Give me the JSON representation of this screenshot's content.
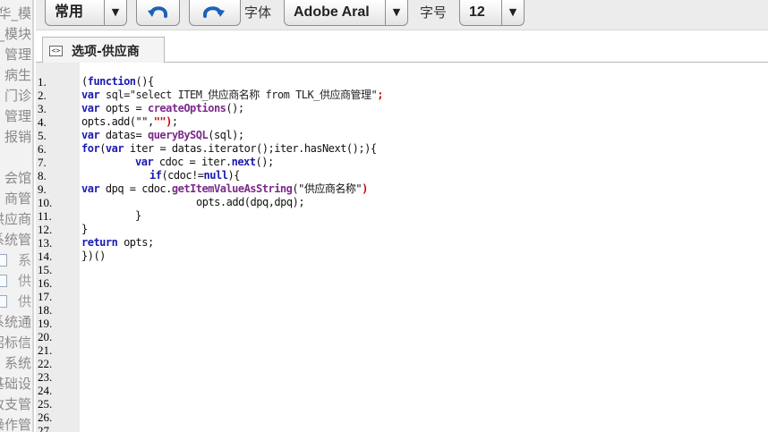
{
  "sidebar": {
    "items": [
      {
        "text": "华_模",
        "child": false
      },
      {
        "text": "_模块",
        "child": false
      },
      {
        "text": "管理",
        "child": false
      },
      {
        "text": "病生",
        "child": false
      },
      {
        "text": "门诊",
        "child": false
      },
      {
        "text": "管理",
        "child": false
      },
      {
        "text": "报销",
        "child": false
      },
      {
        "text": "",
        "child": false
      },
      {
        "text": "会馆",
        "child": false
      },
      {
        "text": "商管",
        "child": false
      },
      {
        "text": "供应商",
        "child": false
      },
      {
        "text": "系统管",
        "child": false
      },
      {
        "text": "系",
        "child": true
      },
      {
        "text": "供",
        "child": true
      },
      {
        "text": "供",
        "child": true
      },
      {
        "text": "系统通",
        "child": false
      },
      {
        "text": "招标信",
        "child": false
      },
      {
        "text": "系统",
        "child": false
      },
      {
        "text": "基础设",
        "child": false
      },
      {
        "text": "收支管",
        "child": false
      },
      {
        "text": "操作管",
        "child": false
      }
    ]
  },
  "toolbar": {
    "style_select": {
      "value": "常用",
      "arrow": "▼"
    },
    "undo_icon": "undo-icon",
    "redo_icon": "redo-icon",
    "font_label": "字体",
    "font_select": {
      "value": "Adobe Aral",
      "arrow": "▼"
    },
    "size_label": "字号",
    "size_select": {
      "value": "12",
      "arrow": "▼"
    }
  },
  "tab": {
    "icon_text": "<>",
    "label": "选项-供应商"
  },
  "editor": {
    "line_numbers": [
      "1.",
      "2.",
      "3.",
      "4.",
      "5.",
      "6.",
      "7.",
      "8.",
      "9.",
      "10.",
      "11.",
      "12.",
      "13.",
      "14.",
      "15.",
      "16.",
      "17.",
      "18.",
      "19.",
      "20.",
      "21.",
      "22.",
      "23.",
      "24.",
      "25.",
      "26.",
      "27."
    ],
    "lines": [
      {
        "indent": 0,
        "tokens": [
          {
            "t": "(",
            "c": ""
          },
          {
            "t": "function",
            "c": "kw"
          },
          {
            "t": "(){",
            "c": ""
          }
        ]
      },
      {
        "indent": 0,
        "tokens": [
          {
            "t": "var",
            "c": "kw"
          },
          {
            "t": " sql=\"select ITEM_供应商名称 from TLK_供应商管理\"",
            "c": "str"
          },
          {
            "t": ";",
            "c": "red"
          }
        ]
      },
      {
        "indent": 0,
        "tokens": [
          {
            "t": "var",
            "c": "kw"
          },
          {
            "t": " opts = ",
            "c": ""
          },
          {
            "t": "createOptions",
            "c": "fn"
          },
          {
            "t": "();",
            "c": ""
          }
        ]
      },
      {
        "indent": 0,
        "tokens": [
          {
            "t": "opts.add(\"\",",
            "c": ""
          },
          {
            "t": "\"\")",
            "c": "red"
          },
          {
            "t": ";",
            "c": ""
          }
        ]
      },
      {
        "indent": 0,
        "tokens": [
          {
            "t": "var",
            "c": "kw"
          },
          {
            "t": " datas= ",
            "c": ""
          },
          {
            "t": "queryBySQL",
            "c": "fn"
          },
          {
            "t": "(sql);",
            "c": ""
          }
        ]
      },
      {
        "indent": 0,
        "tokens": [
          {
            "t": "for",
            "c": "kw"
          },
          {
            "t": "(",
            "c": ""
          },
          {
            "t": "var",
            "c": "kw"
          },
          {
            "t": " iter = datas.iterator();iter.hasNext();){",
            "c": ""
          }
        ]
      },
      {
        "indent": 60,
        "tokens": [
          {
            "t": "var",
            "c": "kw"
          },
          {
            "t": " cdoc = iter.",
            "c": ""
          },
          {
            "t": "next",
            "c": "kw"
          },
          {
            "t": "();",
            "c": ""
          }
        ]
      },
      {
        "indent": 76,
        "tokens": [
          {
            "t": "if",
            "c": "kw"
          },
          {
            "t": "(cdoc!=",
            "c": ""
          },
          {
            "t": "null",
            "c": "kw"
          },
          {
            "t": "){",
            "c": ""
          }
        ]
      },
      {
        "indent": 0,
        "tokens": [
          {
            "t": "var",
            "c": "kw"
          },
          {
            "t": " dpq = cdoc.",
            "c": ""
          },
          {
            "t": "getItemValueAsString",
            "c": "fn"
          },
          {
            "t": "(\"供应商名称\"",
            "c": ""
          },
          {
            "t": ")",
            "c": "red"
          }
        ]
      },
      {
        "indent": 128,
        "tokens": [
          {
            "t": "opts.add(dpq,dpq);",
            "c": ""
          }
        ]
      },
      {
        "indent": 60,
        "tokens": [
          {
            "t": "}",
            "c": ""
          }
        ]
      },
      {
        "indent": 0,
        "tokens": [
          {
            "t": "}",
            "c": ""
          }
        ]
      },
      {
        "indent": 0,
        "tokens": [
          {
            "t": "return",
            "c": "kw"
          },
          {
            "t": " opts;",
            "c": ""
          }
        ]
      },
      {
        "indent": 0,
        "tokens": [
          {
            "t": "})()",
            "c": ""
          }
        ]
      }
    ]
  }
}
